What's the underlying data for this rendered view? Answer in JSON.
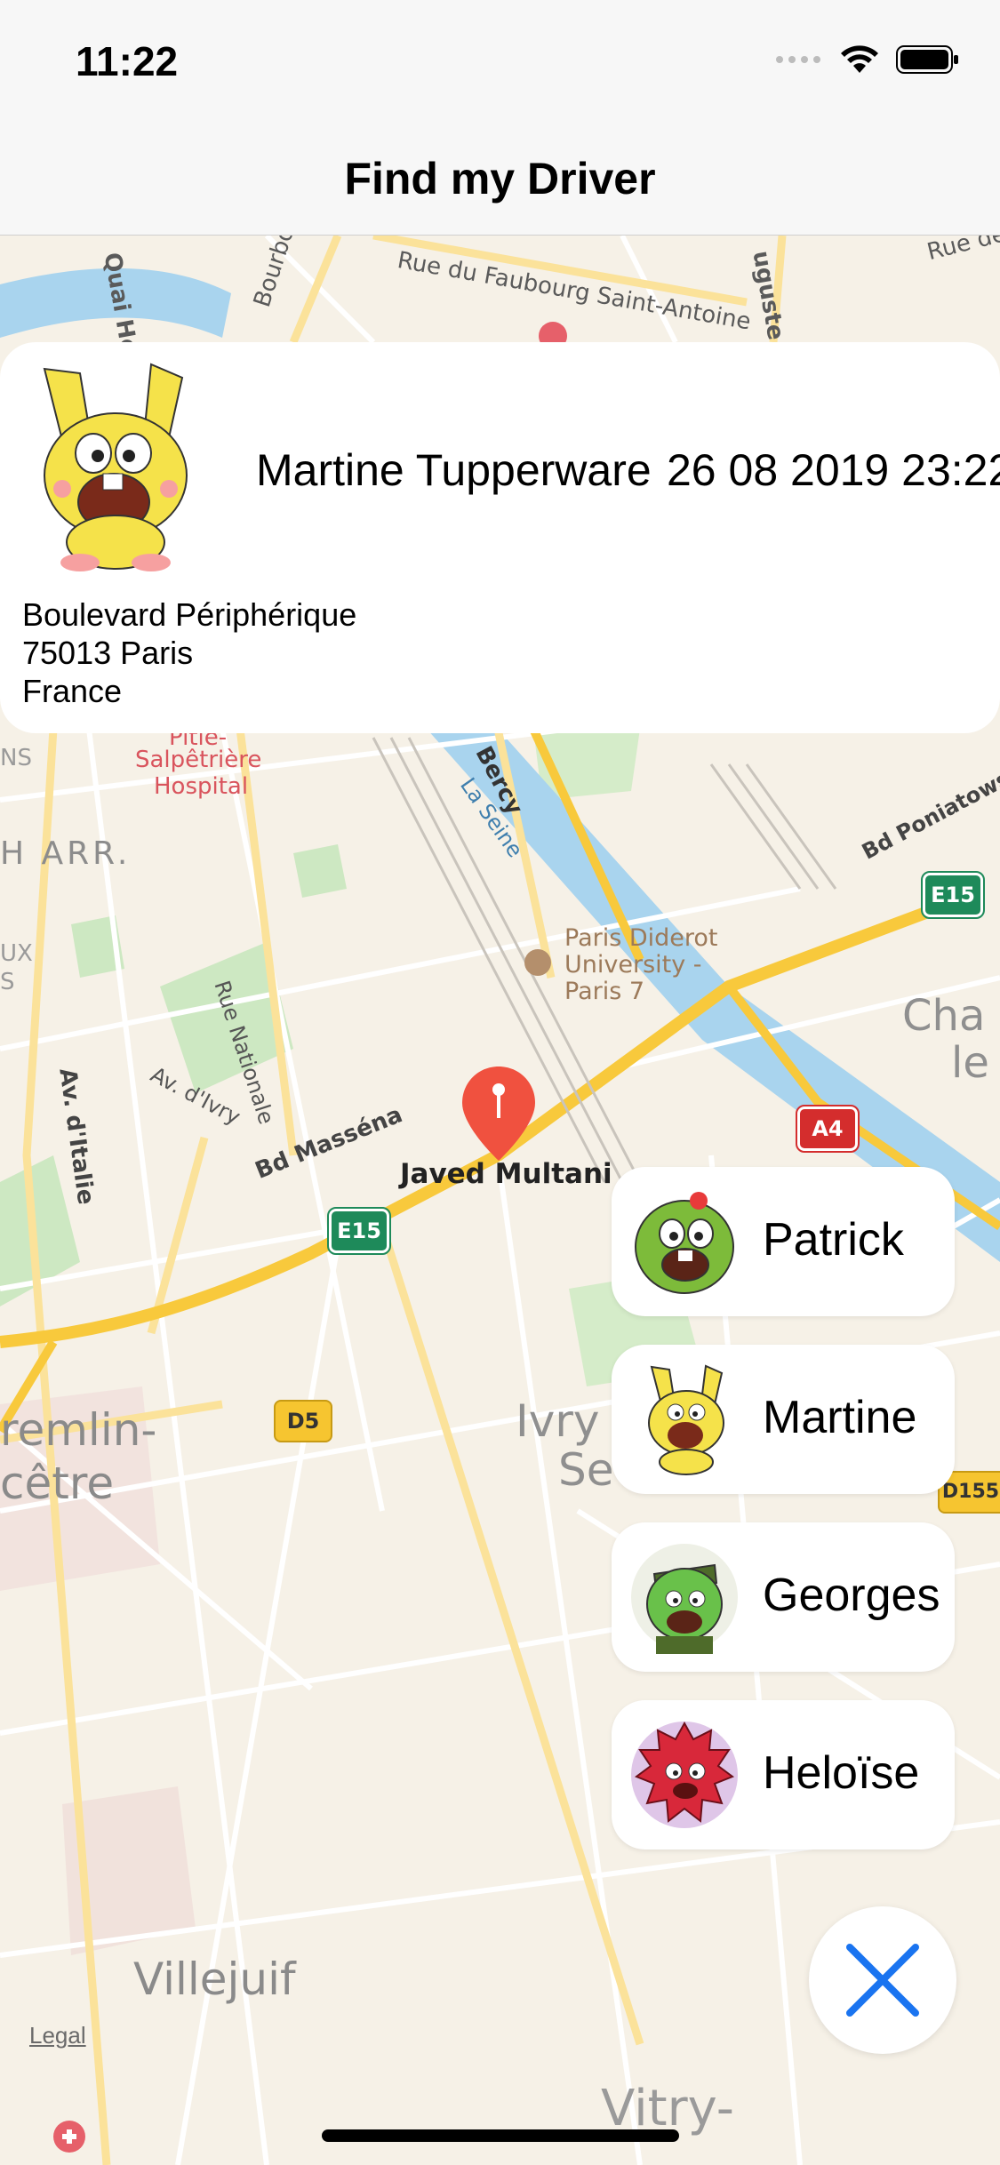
{
  "status_bar": {
    "time": "11:22"
  },
  "nav": {
    "title": "Find my Driver"
  },
  "selected_driver": {
    "name": "Martine Tupperware",
    "datetime": "26 08 2019 23:22:",
    "address_line1": "Boulevard Périphérique",
    "address_line2": "75013 Paris",
    "address_line3": "France"
  },
  "drivers": [
    {
      "label": "Patrick",
      "avatar": "green-creature-avatar"
    },
    {
      "label": "Martine",
      "avatar": "yellow-rabbit-avatar"
    },
    {
      "label": "Georges",
      "avatar": "green-soldier-avatar"
    },
    {
      "label": "Heloïse",
      "avatar": "red-porcupine-avatar"
    }
  ],
  "map": {
    "pin_label": "Javed Multani",
    "legal": "Legal",
    "labels": {
      "quai": "Quai Her",
      "bourbon": "Bourbon",
      "faubourg": "Rue du Faubourg Saint-Antoine",
      "auguste": "uguste",
      "rue_de": "Rue de",
      "hospital_1": "Pitié-",
      "hospital_2": "Salpêtrière",
      "hospital_3": "Hospital",
      "arr": "H ARR.",
      "ux": "UX",
      "ns": "NS",
      "s": "S",
      "bercy": "Bercy",
      "la_seine": "La Seine",
      "poniatowski": "Bd Poniatows",
      "e15_right": "E15",
      "e15_left": "E15",
      "a4": "A4",
      "d5": "D5",
      "d155": "D155",
      "university_1": "Paris Diderot",
      "university_2": "University -",
      "university_3": "Paris 7",
      "rue_nationale": "Rue Nationale",
      "av_ivry": "Av. d'Ivry",
      "av_italie": "Av. d'Italie",
      "masse": "Bd Masséna",
      "cha": "Cha",
      "le": "le",
      "kremlin_1": "remlin-",
      "kremlin_2": "cêtre",
      "ivry_1": "Ivry",
      "ivry_2": "Se",
      "villejuif": "Villejuif",
      "vitry": "Vitry-"
    }
  },
  "colors": {
    "map_bg": "#f6f1e7",
    "highway": "#f8c93c",
    "river": "#a9d4ee",
    "park": "#cde8c2",
    "pin": "#f0513f",
    "close_x": "#1a74f0"
  }
}
